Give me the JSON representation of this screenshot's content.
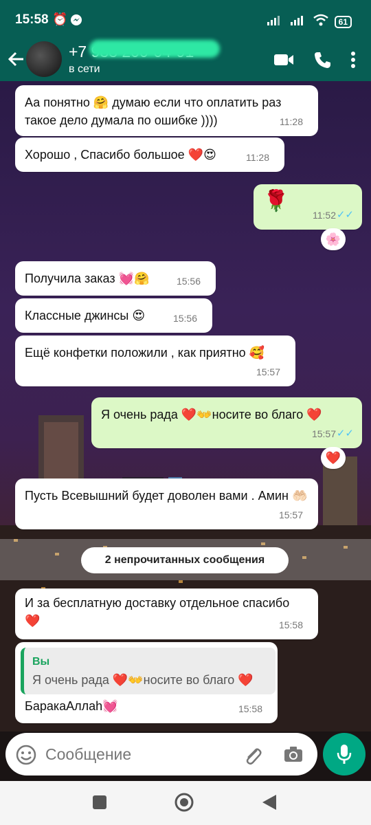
{
  "status_bar": {
    "time": "15:58",
    "battery": "61"
  },
  "header": {
    "contact_name": "+7 988 200-04-91",
    "status": "в сети"
  },
  "messages": [
    {
      "direction": "in",
      "text": "Аа понятно 🤗 думаю если что оплатить раз такое дело думала по ошибке ))))",
      "time": "11:28"
    },
    {
      "direction": "in",
      "text": "Хорошо , Спасибо большое ❤️😍",
      "time": "11:28"
    },
    {
      "direction": "out",
      "text": "🌹",
      "time": "11:52",
      "reaction": "🌸"
    },
    {
      "direction": "in",
      "text": "Получила заказ 💓🤗",
      "time": "15:56"
    },
    {
      "direction": "in",
      "text": "Классные джинсы 😍",
      "time": "15:56"
    },
    {
      "direction": "in",
      "text": "Ещё конфетки положили , как приятно 🥰",
      "time": "15:57"
    },
    {
      "direction": "out",
      "text": "Я очень рада ❤️👐носите во благо ❤️",
      "time": "15:57",
      "reaction": "❤️"
    },
    {
      "direction": "in",
      "text": "Пусть Всевышний будет доволен вами . Амин 🤲🏻",
      "time": "15:57"
    },
    {
      "direction": "in",
      "text": "И за бесплатную доставку отдельное спасибо ❤️",
      "time": "15:58"
    },
    {
      "direction": "in",
      "text": "БаракаАллаh💓",
      "time": "15:58",
      "quote_author": "Вы",
      "quote_text": "Я очень рада ❤️👐носите во благо ❤️"
    }
  ],
  "unread_banner": "2 непрочитанных сообщения",
  "composer": {
    "placeholder": "Сообщение"
  },
  "colors": {
    "header": "#075e54",
    "outgoing_bubble": "#dcf8c6",
    "incoming_bubble": "#ffffff",
    "accent": "#00a884",
    "read_tick": "#4fc3f7"
  }
}
